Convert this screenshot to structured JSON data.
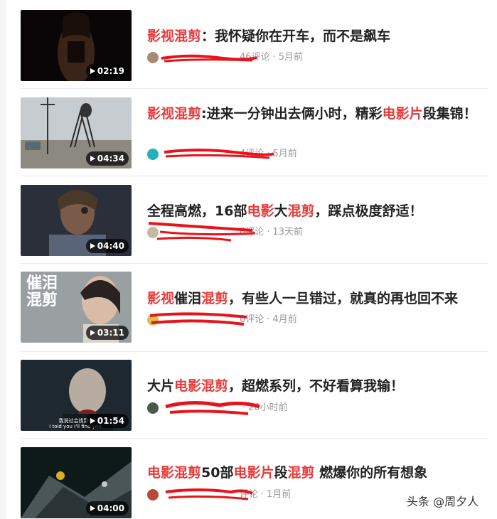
{
  "items": [
    {
      "title_parts": [
        {
          "text": "影视混剪",
          "hl": true
        },
        {
          "text": "：我怀疑你在开车，而不是飙车",
          "hl": false
        }
      ],
      "source": "",
      "comments": "46评论",
      "time": "5月前",
      "duration": "02:19",
      "avatar_color": "#a88a74"
    },
    {
      "title_parts": [
        {
          "text": "影视混剪",
          "hl": true
        },
        {
          "text": ":进来一分钟出去俩小时，精彩",
          "hl": false
        },
        {
          "text": "电影片",
          "hl": true
        },
        {
          "text": "段集锦！",
          "hl": false
        }
      ],
      "source": "",
      "comments": "4评论",
      "time": "5月前",
      "duration": "04:34",
      "avatar_color": "#1fb2b7"
    },
    {
      "title_parts": [
        {
          "text": "全程高燃，16部",
          "hl": false
        },
        {
          "text": "电影",
          "hl": true
        },
        {
          "text": "大",
          "hl": false
        },
        {
          "text": "混剪",
          "hl": true
        },
        {
          "text": "，踩点极度舒适！",
          "hl": false
        }
      ],
      "source": "",
      "comments": "0评论",
      "time": "13天前",
      "duration": "04:40",
      "avatar_color": "#c8b9a2"
    },
    {
      "title_parts": [
        {
          "text": "影视",
          "hl": true
        },
        {
          "text": "催泪",
          "hl": false
        },
        {
          "text": "混剪",
          "hl": true
        },
        {
          "text": "，有些人一旦错过，就真的再也回不来",
          "hl": false
        }
      ],
      "source": "",
      "comments": "0评论",
      "time": "4月前",
      "duration": "03:11",
      "avatar_color": "#d9c04a"
    },
    {
      "title_parts": [
        {
          "text": "大片",
          "hl": false
        },
        {
          "text": "电影混剪",
          "hl": true
        },
        {
          "text": "，超燃系列，不好看算我输！",
          "hl": false
        }
      ],
      "source": "",
      "comments": "",
      "time": "20小时前",
      "duration": "01:54",
      "avatar_color": "#4a5a4a"
    },
    {
      "title_parts": [
        {
          "text": "电影混剪",
          "hl": true
        },
        {
          "text": "50部",
          "hl": false
        },
        {
          "text": "电影片",
          "hl": true
        },
        {
          "text": "段",
          "hl": false
        },
        {
          "text": "混剪",
          "hl": true
        },
        {
          "text": " 燃爆你的所有想象",
          "hl": false
        }
      ],
      "source": "",
      "comments": "评论",
      "time": "1月前",
      "duration": "04:00",
      "avatar_color": "#b94a3a"
    }
  ],
  "thumbnail_captions": {
    "item3_vertical": "催泪混剪",
    "item4_sub_cn": "我说过会找到你",
    "item4_sub_en": "I told you I'll find you."
  },
  "separator": "·",
  "watermark": "头条 @周夕人",
  "colors": {
    "highlight": "#e83a3a",
    "title": "#222222",
    "meta": "#999999",
    "redaction": "#e8141b"
  }
}
